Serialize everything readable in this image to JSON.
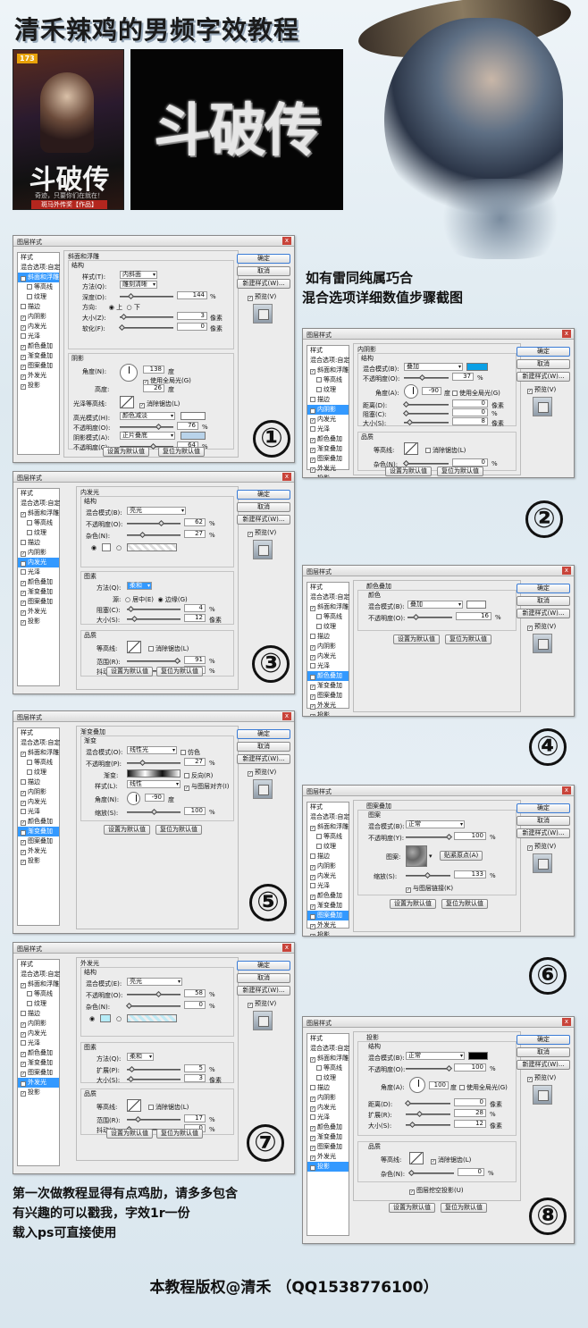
{
  "header": {
    "title": "清禾辣鸡的男频字效教程"
  },
  "poster": {
    "badge": "173",
    "title": "斗破传",
    "tagline": "奇迹，只要你们在就在！",
    "footer": "斑马外传奖【作品】"
  },
  "logo": {
    "text": "斗破传"
  },
  "note": {
    "line1": "如有雷同纯属巧合",
    "line2": "混合选项详细数值步骤截图"
  },
  "dialog": {
    "title": "图层样式",
    "close": "x",
    "buttons": {
      "ok": "确定",
      "cancel": "取消",
      "new_style": "新建样式(W)...",
      "preview": "预览(V)"
    },
    "defaults": {
      "set_default": "设置为默认值",
      "reset_default": "复位为默认值"
    },
    "sidebar": {
      "styles": "样式",
      "blend": "混合选项:自定",
      "bevel": "斜面和浮雕",
      "contour": "等高线",
      "texture": "纹理",
      "stroke": "描边",
      "inner_shadow": "内阴影",
      "inner_glow": "内发光",
      "satin": "光泽",
      "color_overlay": "颜色叠加",
      "gradient_overlay": "渐变叠加",
      "pattern_overlay": "图案叠加",
      "outer_glow": "外发光",
      "drop_shadow": "投影"
    }
  },
  "d1": {
    "section": "斜面和浮雕",
    "struct": "结构",
    "style_l": "样式(T):",
    "style_v": "内斜面",
    "method_l": "方法(Q):",
    "method_v": "雕刻清晰",
    "depth_l": "深度(D):",
    "depth_v": "144",
    "unit_pct": "%",
    "dir_l": "方向:",
    "dir_up": "上",
    "dir_down": "下",
    "size_l": "大小(Z):",
    "size_v": "3",
    "unit_px": "像素",
    "soft_l": "软化(F):",
    "soft_v": "0",
    "shading": "阴影",
    "angle_l": "角度(N):",
    "angle_v": "138",
    "unit_deg": "度",
    "global": "使用全局光(G)",
    "alt_l": "高度:",
    "alt_v": "26",
    "gloss_l": "光泽等高线:",
    "anti": "消除锯齿(L)",
    "hl_mode_l": "高光模式(H):",
    "hl_mode_v": "颜色减淡",
    "hl_op_l": "不透明度(O):",
    "hl_op_v": "76",
    "sh_mode_l": "阴影模式(A):",
    "sh_mode_v": "正片叠底",
    "sh_op_l": "不透明度(C):",
    "sh_op_v": "64",
    "hl_level": 0.76,
    "sh_level": 0.64
  },
  "d2": {
    "section": "内阴影",
    "struct": "结构",
    "mode_l": "混合模式(B):",
    "mode_v": "叠加",
    "color": "#0aa0e6",
    "op_l": "不透明度(O):",
    "op_v": "37",
    "angle_l": "角度(A):",
    "angle_v": "-90",
    "global": "使用全局光(G)",
    "dist_l": "距离(D):",
    "dist_v": "0",
    "choke_l": "阻塞(C):",
    "choke_v": "0",
    "size_l": "大小(S):",
    "size_v": "8",
    "quality": "品质",
    "contour_l": "等高线:",
    "anti": "消除锯齿(L)",
    "noise_l": "杂色(N):",
    "noise_v": "0"
  },
  "d3": {
    "section": "内发光",
    "struct": "结构",
    "mode_l": "混合模式(B):",
    "mode_v": "亮光",
    "op_l": "不透明度(O):",
    "op_v": "62",
    "noise_l": "杂色(N):",
    "noise_v": "27",
    "elements": "图素",
    "tech_l": "方法(Q):",
    "tech_v": "柔和",
    "src_l": "源:",
    "src_center": "居中(E)",
    "src_edge": "边缘(G)",
    "choke_l": "阻塞(C):",
    "choke_v": "4",
    "size_l": "大小(S):",
    "size_v": "12",
    "quality": "品质",
    "contour_l": "等高线:",
    "anti": "消除锯齿(L)",
    "range_l": "范围(R):",
    "range_v": "91",
    "jitter_l": "抖动(J):",
    "jitter_v": "0"
  },
  "d4": {
    "section": "颜色叠加",
    "sub": "颜色",
    "mode_l": "混合模式(B):",
    "mode_v": "叠加",
    "color": "#ffffff",
    "op_l": "不透明度(O):",
    "op_v": "16"
  },
  "d5": {
    "section": "渐变叠加",
    "sub": "渐变",
    "mode_l": "混合模式(O):",
    "mode_v": "线性光",
    "dither": "仿色",
    "op_l": "不透明度(P):",
    "op_v": "27",
    "grad_l": "渐变:",
    "reverse": "反向(R)",
    "style_l": "样式(L):",
    "style_v": "线性",
    "align": "与图层对齐(I)",
    "angle_l": "角度(N):",
    "angle_v": "-90",
    "scale_l": "缩放(S):",
    "scale_v": "100"
  },
  "d6": {
    "section": "图案叠加",
    "sub": "图案",
    "mode_l": "混合模式(B):",
    "mode_v": "正常",
    "op_l": "不透明度(Y):",
    "op_v": "100",
    "pat_l": "图案:",
    "snap": "贴紧原点(A)",
    "scale_l": "缩放(S):",
    "scale_v": "133",
    "link": "与图层链接(K)"
  },
  "d7": {
    "section": "外发光",
    "struct": "结构",
    "mode_l": "混合模式(E):",
    "mode_v": "亮光",
    "op_l": "不透明度(O):",
    "op_v": "58",
    "noise_l": "杂色(N):",
    "noise_v": "0",
    "elements": "图素",
    "tech_l": "方法(Q):",
    "tech_v": "柔和",
    "spread_l": "扩展(P):",
    "spread_v": "5",
    "size_l": "大小(S):",
    "size_v": "3",
    "quality": "品质",
    "contour_l": "等高线:",
    "anti": "消除锯齿(L)",
    "range_l": "范围(R):",
    "range_v": "17",
    "jitter_l": "抖动(J):",
    "jitter_v": "0"
  },
  "d8": {
    "section": "投影",
    "struct": "结构",
    "mode_l": "混合模式(B):",
    "mode_v": "正常",
    "color": "#000000",
    "op_l": "不透明度(O):",
    "op_v": "100",
    "angle_l": "角度(A):",
    "angle_v": "100",
    "global": "使用全局光(G)",
    "dist_l": "距离(D):",
    "dist_v": "0",
    "spread_l": "扩展(R):",
    "spread_v": "28",
    "size_l": "大小(S):",
    "size_v": "12",
    "quality": "品质",
    "contour_l": "等高线:",
    "anti": "消除锯齿(L)",
    "noise_l": "杂色(N):",
    "noise_v": "0",
    "knock": "图层挖空投影(U)"
  },
  "numbers": {
    "n1": "①",
    "n2": "②",
    "n3": "③",
    "n4": "④",
    "n5": "⑤",
    "n6": "⑥",
    "n7": "⑦",
    "n8": "⑧"
  },
  "footer": {
    "line1": "第一次做教程显得有点鸡肋，请多多包含",
    "line2": "有兴趣的可以戳我，字效1r一份",
    "line3": "载入ps可直接使用",
    "copyright": "本教程版权@清禾 （QQ1538776100）"
  }
}
